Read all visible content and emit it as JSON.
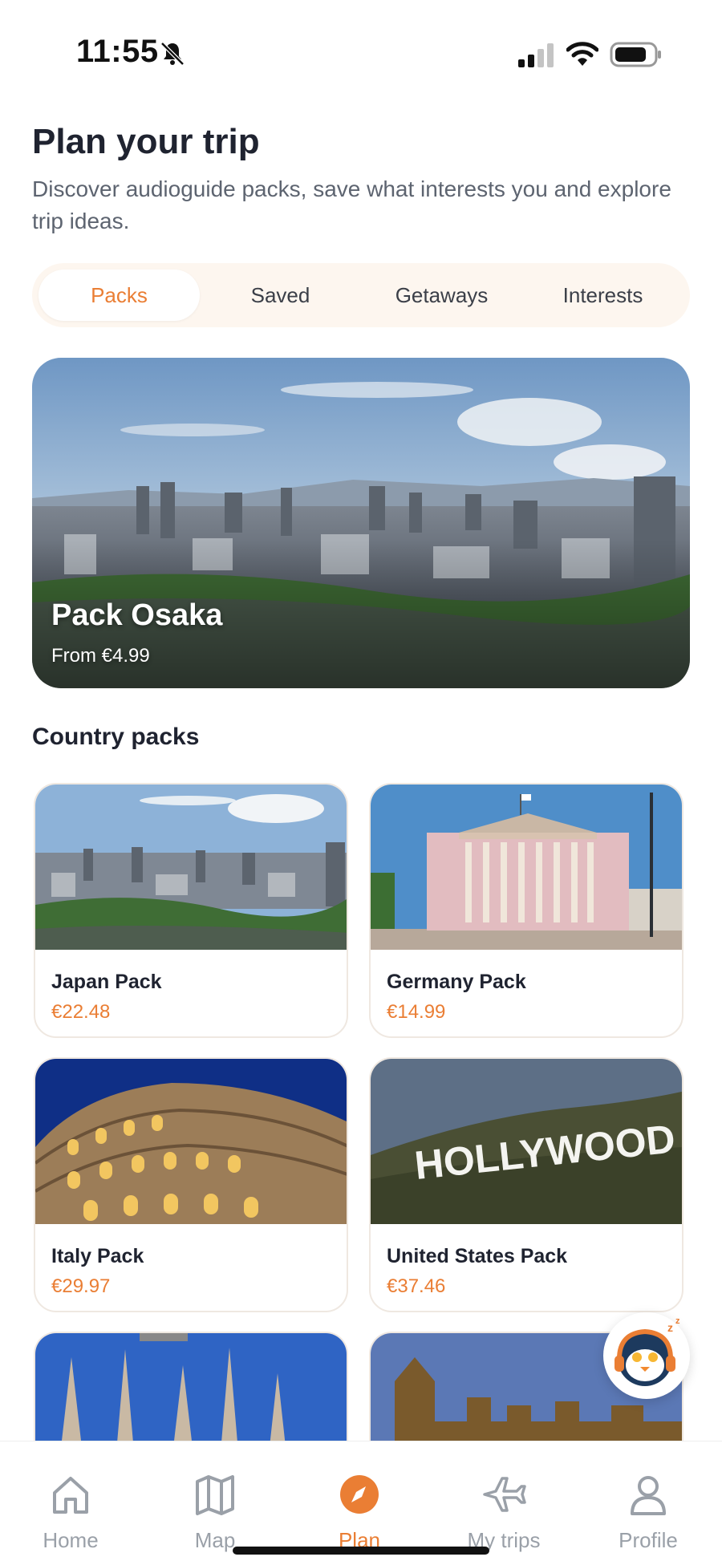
{
  "status": {
    "time": "11:55"
  },
  "header": {
    "title": "Plan your trip",
    "subtitle": "Discover audioguide packs, save what interests you and explore trip ideas."
  },
  "tabs": [
    {
      "label": "Packs",
      "active": true
    },
    {
      "label": "Saved",
      "active": false
    },
    {
      "label": "Getaways",
      "active": false
    },
    {
      "label": "Interests",
      "active": false
    }
  ],
  "hero": {
    "title": "Pack Osaka",
    "price": "From €4.99"
  },
  "section": {
    "title": "Country packs"
  },
  "packs": [
    {
      "name": "Japan Pack",
      "price": "€22.48",
      "image": "osaka-skyline"
    },
    {
      "name": "Germany Pack",
      "price": "€14.99",
      "image": "berlin-opera"
    },
    {
      "name": "Italy Pack",
      "price": "€29.97",
      "image": "colosseum"
    },
    {
      "name": "United States Pack",
      "price": "€37.46",
      "image": "hollywood-sign"
    },
    {
      "image": "sagrada-familia"
    },
    {
      "image": "westminster"
    }
  ],
  "hollywood_sign_text": "HOLLYWOOD",
  "nav": [
    {
      "label": "Home",
      "icon": "home-icon"
    },
    {
      "label": "Map",
      "icon": "map-icon"
    },
    {
      "label": "Plan",
      "icon": "compass-icon",
      "active": true
    },
    {
      "label": "My trips",
      "icon": "plane-icon"
    },
    {
      "label": "Profile",
      "icon": "profile-icon"
    }
  ],
  "colors": {
    "accent": "#ea7e34",
    "tab_bg": "#fdf6ef",
    "text": "#1f2330"
  }
}
